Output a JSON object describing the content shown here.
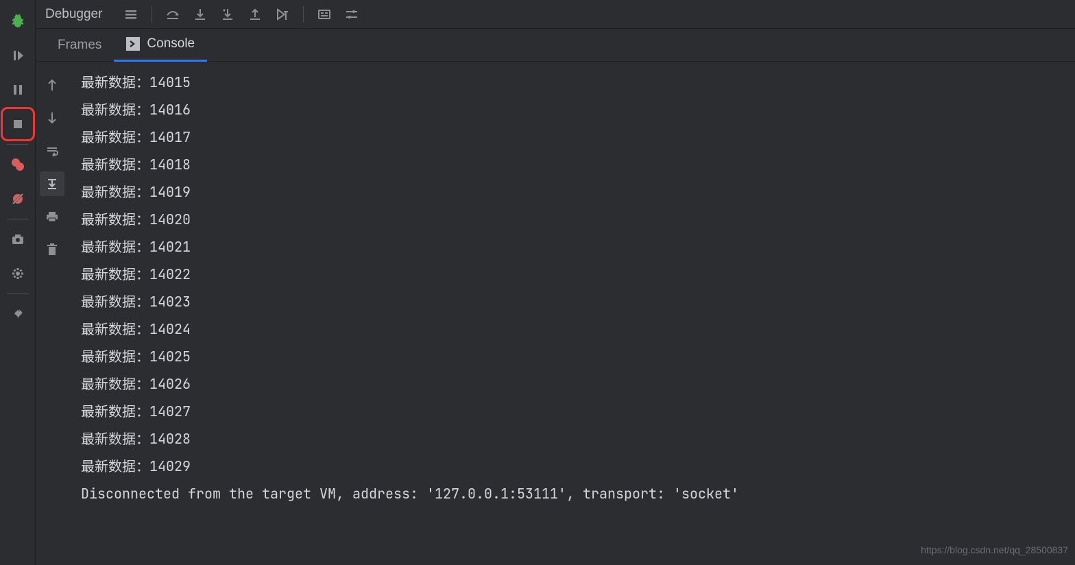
{
  "toolbar": {
    "title": "Debugger"
  },
  "tabs": {
    "frames": "Frames",
    "console": "Console"
  },
  "console": {
    "prefix": "最新数据：",
    "values": [
      "14015",
      "14016",
      "14017",
      "14018",
      "14019",
      "14020",
      "14021",
      "14022",
      "14023",
      "14024",
      "14025",
      "14026",
      "14027",
      "14028",
      "14029"
    ],
    "disconnect": "Disconnected from the target VM, address: '127.0.0.1:53111', transport: 'socket'"
  },
  "watermark": "https://blog.csdn.net/qq_28500837"
}
